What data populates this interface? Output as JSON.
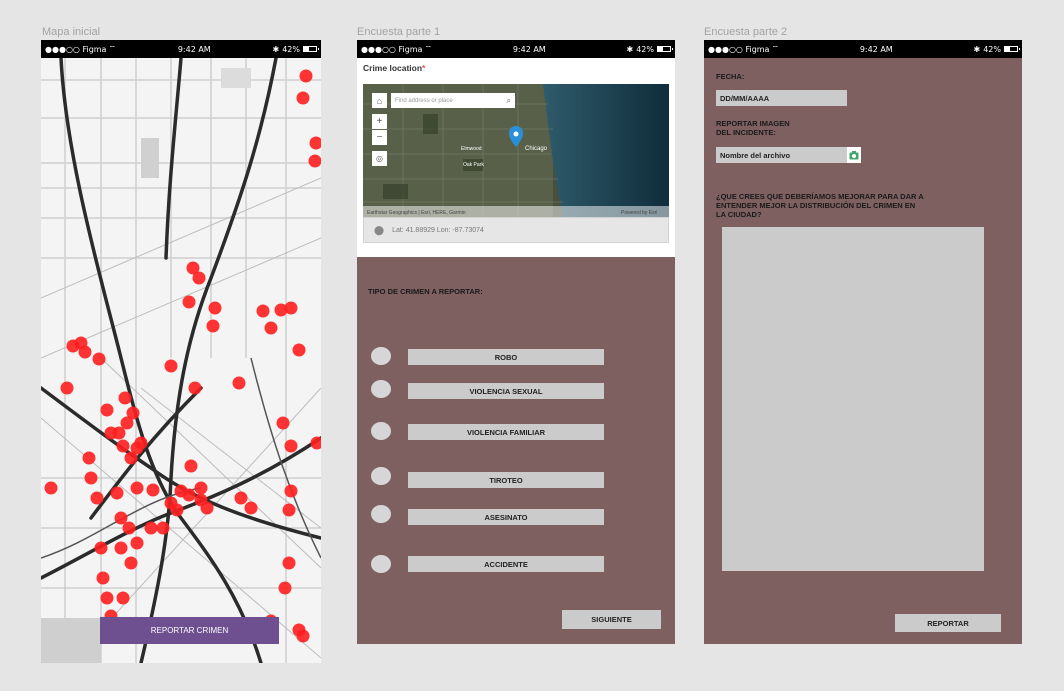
{
  "frames": {
    "map": {
      "title": "Mapa inicial",
      "report_button": "REPORTAR CRIMEN"
    },
    "survey1": {
      "title": "Encuesta parte 1",
      "location_label": "Crime location",
      "required_mark": "*",
      "search_placeholder": "Find address or place",
      "map_labels": [
        "Chicago",
        "Elmwood",
        "Oak Park",
        "Chicago"
      ],
      "attribution": "Earthstar Geographics | Esri, HERE, Garmin",
      "powered_by": "Powered by Esri",
      "latlon": "Lat: 41.88929   Lon: -87.73074",
      "crime_type_label": "TIPO DE CRIMEN A REPORTAR:",
      "options": [
        "ROBO",
        "VIOLENCIA SEXUAL",
        "VIOLENCIA FAMILIAR",
        "TIROTEO",
        "ASESINATO",
        "ACCIDENTE"
      ],
      "next_button": "SIGUIENTE"
    },
    "survey2": {
      "title": "Encuesta parte 2",
      "date_label": "FECHA:",
      "date_value": "DD/MM/AAAA",
      "image_label_1": "REPORTAR IMAGEN",
      "image_label_2": "DEL INCIDENTE:",
      "file_value": "Nombre del archivo",
      "question_1": "¿QUE CREES QUE DEBERÍAMOS MEJORAR PARA DAR A",
      "question_2": "ENTENDER MEJOR LA DISTRIBUCIÓN DEL CRIMEN EN",
      "question_3": "LA CIUDAD?",
      "submit_button": "REPORTAR"
    }
  },
  "status_bar": {
    "carrier": "●●●○○ Figma",
    "wifi": "wifi-icon",
    "time": "9:42 AM",
    "bluetooth": "✱",
    "battery": "42%"
  },
  "colors": {
    "form_bg": "#7e6061",
    "report_btn": "#6e4f8f",
    "marker": "#ff1f1f",
    "field": "#cbcbcb"
  }
}
